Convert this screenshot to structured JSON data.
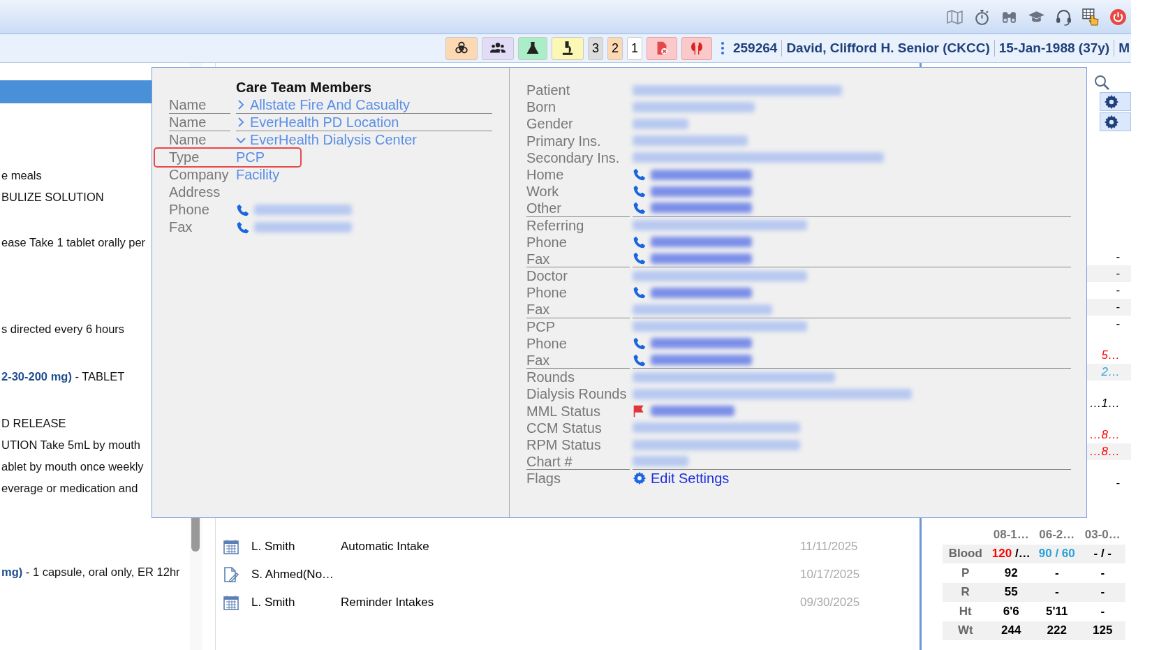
{
  "count_badges": [
    {
      "text": "3",
      "color": "#dcdcdc"
    },
    {
      "text": "2",
      "color": "#fcd9b2"
    },
    {
      "text": "1",
      "color": "#ffffff"
    }
  ],
  "patient_bar": {
    "chart_number": "259264",
    "name": "David, Clifford H. Senior (CKCC)",
    "dob": "15-Jan-1988 (37y)",
    "gender": "M"
  },
  "medications": [
    {
      "lines": [
        "e meals",
        "BULIZE SOLUTION"
      ]
    },
    {
      "lines": [
        "ease Take 1 tablet orally per"
      ]
    },
    {
      "lines": [
        "s directed every 6 hours"
      ]
    },
    {
      "lines": [
        "**2-30-200 mg)** - TABLET"
      ]
    },
    {
      "lines": [
        "D RELEASE",
        "UTION Take 5mL by mouth",
        "ablet by mouth once weekly",
        "everage or medication and"
      ]
    },
    {
      "lines": [
        "**mg)** - 1 capsule, oral only, ER 12hr"
      ]
    }
  ],
  "activity": [
    {
      "kind": "calendar",
      "author": "L. Smith",
      "type": "Automatic Intake",
      "date": "11/11/2025"
    },
    {
      "kind": "note",
      "author": "S. Ahmed(No…",
      "date": "10/17/2025"
    },
    {
      "kind": "calendar",
      "author": "L. Smith",
      "type": "Reminder Intakes",
      "date": "09/30/2025"
    }
  ],
  "readings": [
    [
      {
        "text": "-",
        "color": "#000000"
      },
      {
        "text": "-",
        "color": "#000000"
      },
      {
        "text": "-",
        "color": "#000000"
      },
      {
        "text": "-",
        "color": "#000000"
      },
      {
        "text": "-",
        "color": "#000000"
      }
    ],
    [
      {
        "text": "5…",
        "color": "#ff0000"
      },
      {
        "text": "2…",
        "color": "#29a3d6"
      }
    ],
    [
      {
        "text": "…1…",
        "color": "#000000"
      }
    ],
    [
      {
        "text": "…8…",
        "color": "#ff0000"
      },
      {
        "text": "…8…",
        "color": "#ff0000"
      }
    ],
    [
      {
        "text": "-",
        "color": "#000000"
      }
    ]
  ],
  "vitals": {
    "columns": [
      "08-1…",
      "06-2…",
      "03-0…"
    ],
    "rows": [
      {
        "label": "Blood",
        "cells": [
          [
            {
              "text": "120",
              "color": "#ff0000"
            },
            {
              "text": " /…",
              "color": "#000000"
            }
          ],
          [
            {
              "text": "90 / 60",
              "color": "#29a3d6"
            }
          ],
          [
            {
              "text": "- / -",
              "color": "#000000"
            }
          ]
        ]
      },
      {
        "label": "P",
        "cells": [
          [
            {
              "text": "92",
              "color": "#000000"
            }
          ],
          [
            {
              "text": "-",
              "color": "#000000"
            }
          ],
          [
            {
              "text": "-",
              "color": "#000000"
            }
          ]
        ]
      },
      {
        "label": "R",
        "cells": [
          [
            {
              "text": "55",
              "color": "#000000"
            }
          ],
          [
            {
              "text": "-",
              "color": "#000000"
            }
          ],
          [
            {
              "text": "-",
              "color": "#000000"
            }
          ]
        ]
      },
      {
        "label": "Ht",
        "cells": [
          [
            {
              "text": "6'6",
              "color": "#000000"
            }
          ],
          [
            {
              "text": "5'11",
              "color": "#000000"
            }
          ],
          [
            {
              "text": "-",
              "color": "#000000"
            }
          ]
        ]
      },
      {
        "label": "Wt",
        "cells": [
          [
            {
              "text": "244",
              "color": "#000000"
            }
          ],
          [
            {
              "text": "222",
              "color": "#000000"
            }
          ],
          [
            {
              "text": "125",
              "color": "#000000"
            }
          ]
        ]
      }
    ]
  },
  "care_team": {
    "title": "Care Team Members",
    "rows": [
      {
        "label": "Name",
        "kind": "name",
        "value": "Allstate Fire And Casualty",
        "expanded": false,
        "divider_after": true,
        "highlighted": false
      },
      {
        "label": "Name",
        "kind": "name",
        "value": "EverHealth PD Location",
        "expanded": false,
        "divider_after": true,
        "highlighted": false
      },
      {
        "label": "Name",
        "kind": "name",
        "value": "EverHealth Dialysis Center",
        "expanded": true,
        "divider_after": false,
        "highlighted": false
      },
      {
        "label": "Type",
        "kind": "text",
        "value": "PCP",
        "divider_after": false,
        "highlighted": true
      },
      {
        "label": "Company",
        "kind": "text",
        "value": "Facility",
        "divider_after": false,
        "highlighted": false
      },
      {
        "label": "Address",
        "kind": "text",
        "divider_after": false,
        "highlighted": false
      },
      {
        "label": "Phone",
        "kind": "phone",
        "divider_after": false,
        "highlighted": false
      },
      {
        "label": "Fax",
        "kind": "phone",
        "divider_after": false,
        "highlighted": false
      }
    ]
  },
  "patient_details": [
    {
      "label": "Patient",
      "kind": "blurred",
      "divider_after": false
    },
    {
      "label": "Born",
      "kind": "blurred",
      "divider_after": false
    },
    {
      "label": "Gender",
      "kind": "blurred",
      "divider_after": false
    },
    {
      "label": "Primary Ins.",
      "kind": "blurred",
      "divider_after": false
    },
    {
      "label": "Secondary Ins.",
      "kind": "blurred",
      "divider_after": false
    },
    {
      "label": "Home",
      "kind": "phone",
      "divider_after": false
    },
    {
      "label": "Work",
      "kind": "phone",
      "divider_after": false
    },
    {
      "label": "Other",
      "kind": "phone",
      "divider_after": true
    },
    {
      "label": "Referring",
      "kind": "blurred",
      "divider_after": false
    },
    {
      "label": "Phone",
      "kind": "phone",
      "divider_after": false
    },
    {
      "label": "Fax",
      "kind": "phone",
      "divider_after": true
    },
    {
      "label": "Doctor",
      "kind": "blurred",
      "divider_after": false
    },
    {
      "label": "Phone",
      "kind": "phone",
      "divider_after": false
    },
    {
      "label": "Fax",
      "kind": "blurred",
      "divider_after": true
    },
    {
      "label": "PCP",
      "kind": "blurred",
      "divider_after": false
    },
    {
      "label": "Phone",
      "kind": "phone",
      "divider_after": false
    },
    {
      "label": "Fax",
      "kind": "phone",
      "divider_after": true
    },
    {
      "label": "Rounds",
      "kind": "blurred",
      "divider_after": false
    },
    {
      "label": "Dialysis Rounds",
      "kind": "blurred",
      "divider_after": false
    },
    {
      "label": "MML Status",
      "kind": "flag",
      "divider_after": false
    },
    {
      "label": "CCM Status",
      "kind": "blurred",
      "divider_after": false
    },
    {
      "label": "RPM Status",
      "kind": "blurred",
      "divider_after": false
    },
    {
      "label": "Chart #",
      "kind": "blurred",
      "divider_after": true
    },
    {
      "label": "Flags",
      "kind": "settings",
      "value": "Edit Settings",
      "divider_after": false
    }
  ]
}
